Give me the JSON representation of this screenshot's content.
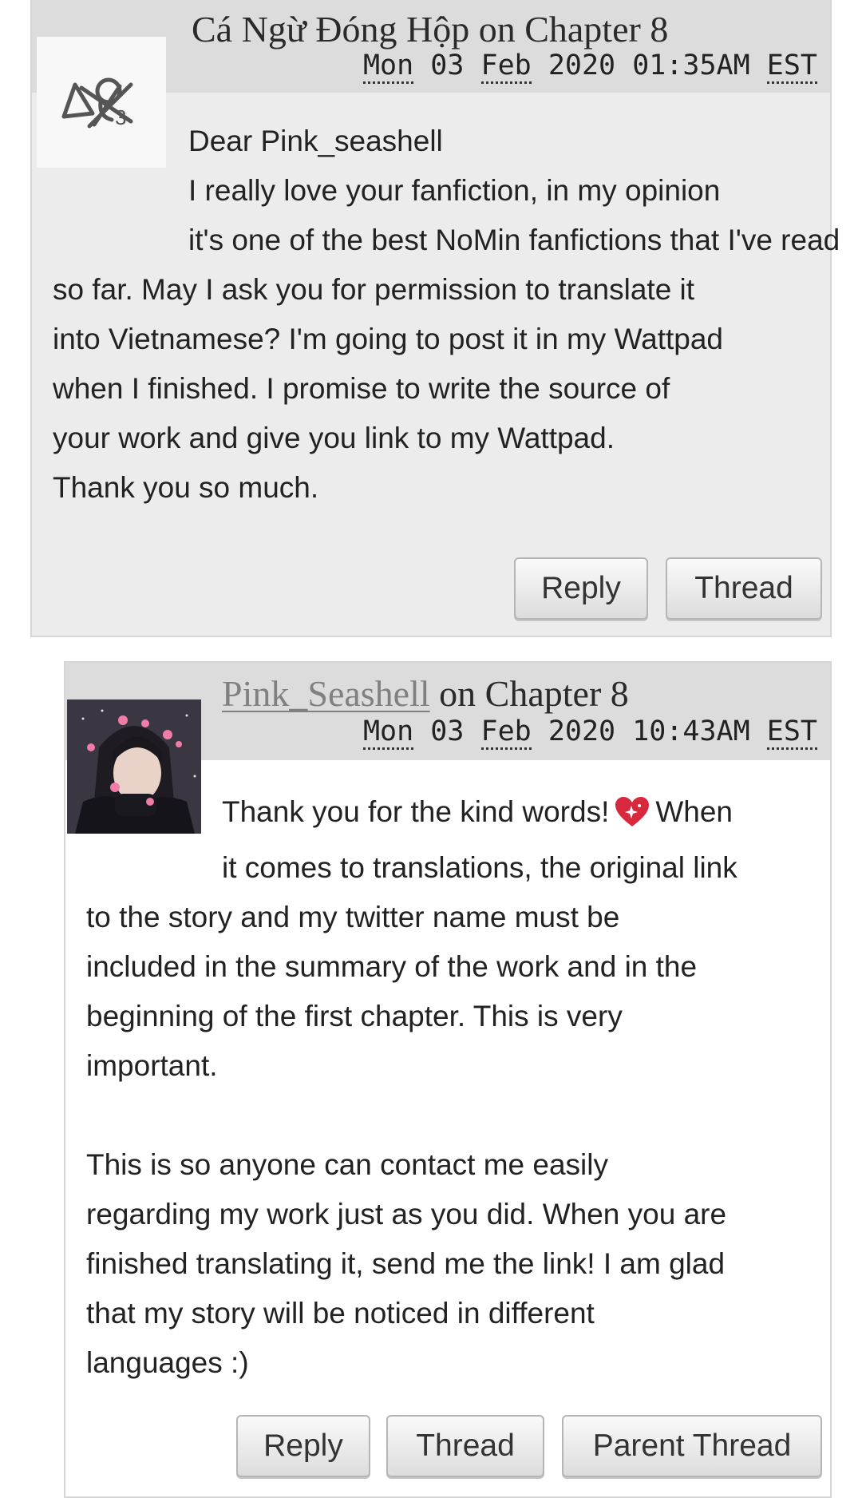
{
  "comments": [
    {
      "author": "Cá Ngừ Đóng Hộp",
      "on_text": "on",
      "chapter": "Chapter 8",
      "date": {
        "day": "Mon",
        "dd": "03",
        "month": "Feb",
        "year": "2020",
        "time": "01:35AM",
        "tz": "EST"
      },
      "body": {
        "greeting": "Dear Pink_seashell",
        "lines": [
          "I really love your fanfiction, in my opinion",
          "it's one of the best NoMin fanfictions that I've read",
          "so far. May I ask you for permission to translate it",
          "into Vietnamese? I'm going to post it in my Wattpad",
          "when I finished. I promise to write the source of",
          "your work and give you link to my Wattpad.",
          "Thank you so much."
        ]
      },
      "buttons": {
        "reply": "Reply",
        "thread": "Thread"
      }
    },
    {
      "author": "Pink_Seashell",
      "on_text": "on",
      "chapter": "Chapter 8",
      "date": {
        "day": "Mon",
        "dd": "03",
        "month": "Feb",
        "year": "2020",
        "time": "10:43AM",
        "tz": "EST"
      },
      "body": {
        "first_line_a": "Thank you for the kind words!",
        "first_line_b": "When",
        "lines": [
          "it comes to translations, the original link",
          "to the story and my twitter name must be",
          "included in the summary of the work and in the",
          "beginning of the first chapter. This is very",
          "important."
        ],
        "lines2": [
          "This is so anyone can contact me easily",
          "regarding my work just as you did. When you are",
          "finished translating it, send me the link! I am glad",
          "that my story will be noticed in different",
          "languages :)"
        ]
      },
      "buttons": {
        "reply": "Reply",
        "thread": "Thread",
        "parent_thread": "Parent Thread"
      },
      "heart_icon": "sparkling-heart-icon",
      "colors": {
        "heart": "#d8283e"
      }
    }
  ]
}
